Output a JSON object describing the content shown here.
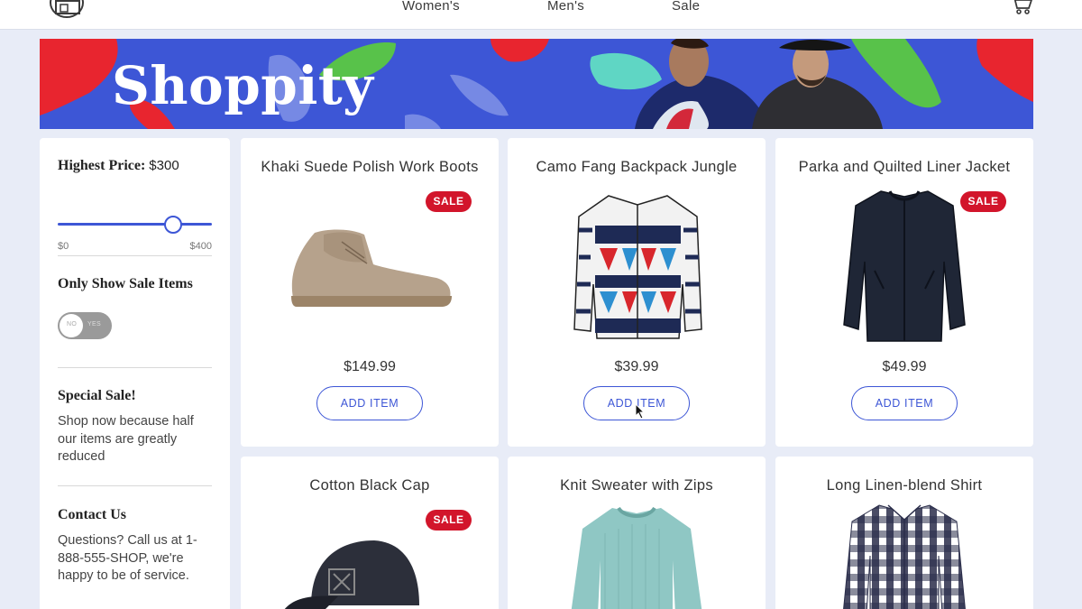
{
  "nav": {
    "links": [
      "Women's",
      "Men's",
      "Sale"
    ]
  },
  "banner": {
    "brand": "Shoppity"
  },
  "sidebar": {
    "price_filter": {
      "label": "Highest Price:",
      "value": "$300",
      "min_label": "$0",
      "max_label": "$400",
      "level": 0.75
    },
    "sale_toggle": {
      "label": "Only Show Sale Items",
      "off_text": "NO",
      "on_text": "YES",
      "state": "NO"
    },
    "special_sale": {
      "heading": "Special Sale!",
      "text": "Shop now because half our items are greatly reduced"
    },
    "contact": {
      "heading": "Contact Us",
      "text": "Questions? Call us at 1-888-555-SHOP, we're happy to be of service."
    }
  },
  "products": [
    {
      "title": "Khaki Suede Polish Work Boots",
      "price": "$149.99",
      "sale": true,
      "badge": "SALE",
      "button": "ADD ITEM",
      "icon": "boot-icon"
    },
    {
      "title": "Camo Fang Backpack Jungle",
      "price": "$39.99",
      "sale": false,
      "badge": "",
      "button": "ADD ITEM",
      "icon": "patterned-cardigan-icon"
    },
    {
      "title": "Parka and Quilted Liner Jacket",
      "price": "$49.99",
      "sale": true,
      "badge": "SALE",
      "button": "ADD ITEM",
      "icon": "navy-jacket-icon"
    },
    {
      "title": "Cotton Black Cap",
      "price": "",
      "sale": true,
      "badge": "SALE",
      "button": "",
      "icon": "black-cap-icon"
    },
    {
      "title": "Knit Sweater with Zips",
      "price": "",
      "sale": false,
      "badge": "",
      "button": "",
      "icon": "mint-sweater-icon"
    },
    {
      "title": "Long Linen-blend Shirt",
      "price": "",
      "sale": false,
      "badge": "",
      "button": "",
      "icon": "plaid-shirt-icon"
    }
  ],
  "colors": {
    "accent": "#3d56d6",
    "sale": "#d2152b",
    "background": "#e8ecf7"
  }
}
